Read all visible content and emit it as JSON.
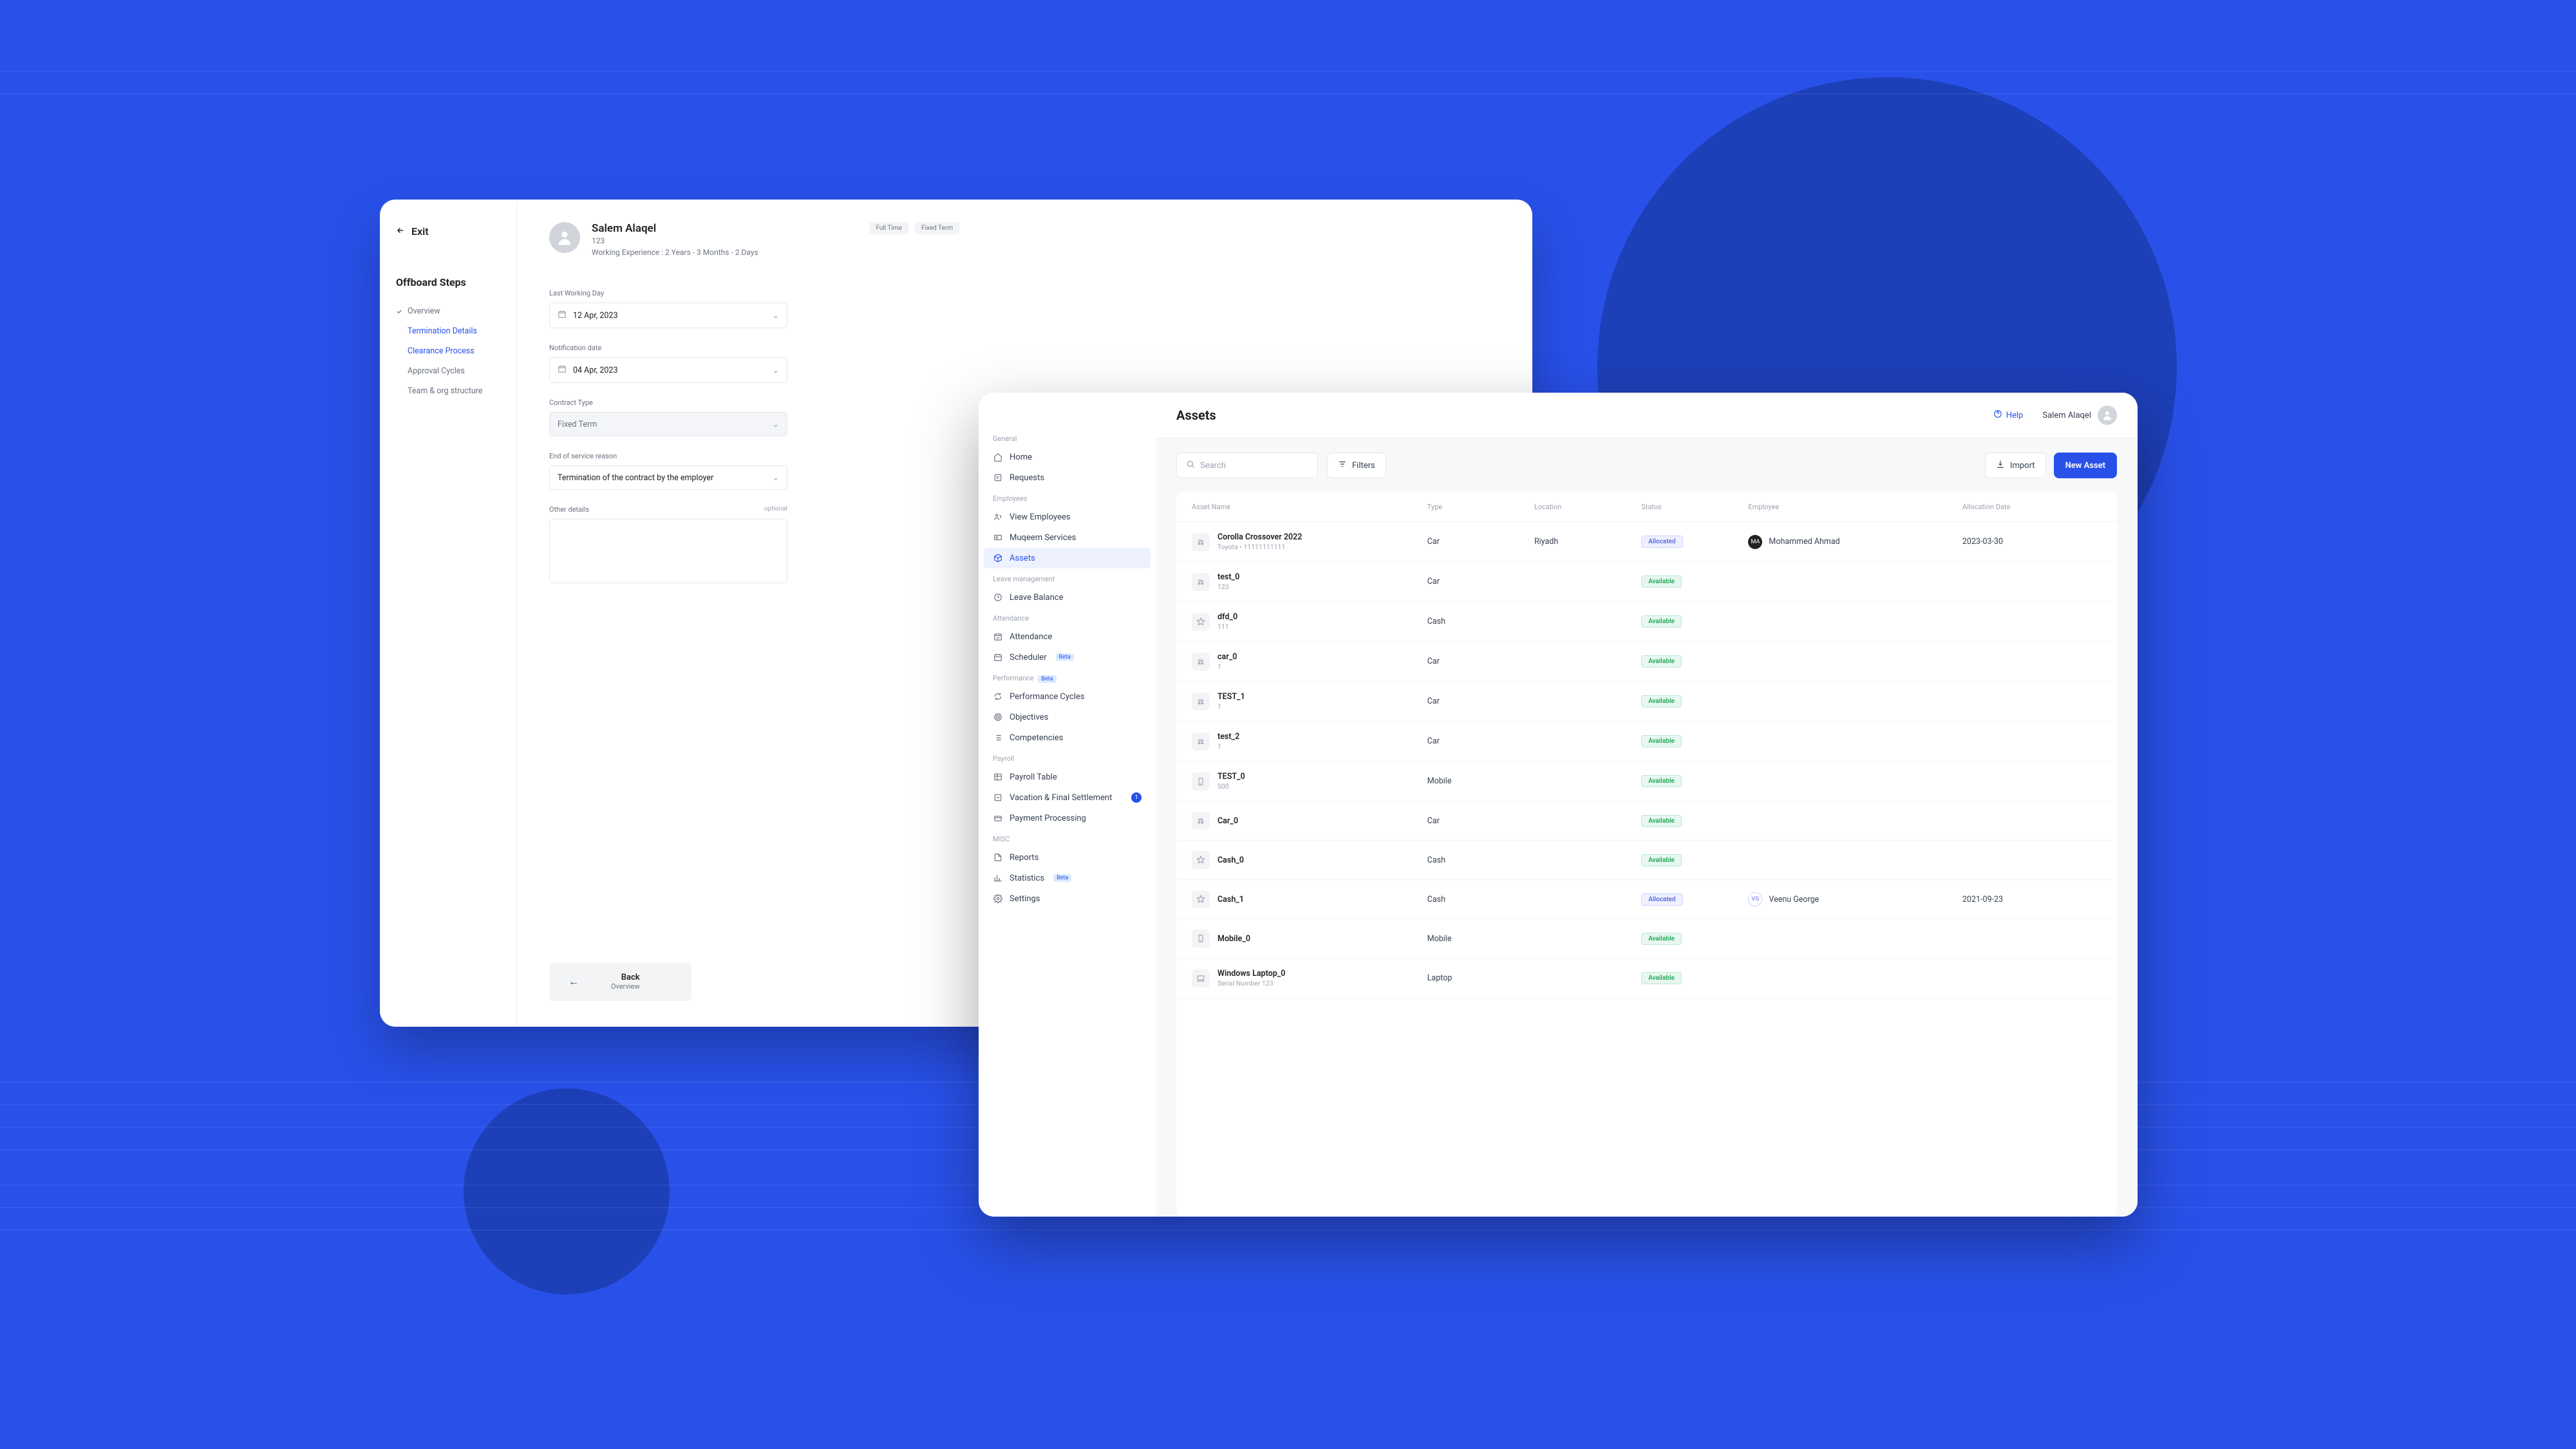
{
  "offboard": {
    "exit_label": "Exit",
    "steps_title": "Offboard Steps",
    "steps": [
      {
        "label": "Overview",
        "state": "done"
      },
      {
        "label": "Termination Details",
        "state": "active"
      },
      {
        "label": "Clearance Process",
        "state": "active"
      },
      {
        "label": "Approval Cycles",
        "state": "pending"
      },
      {
        "label": "Team & org structure",
        "state": "pending"
      }
    ],
    "employee": {
      "name": "Salem Alaqel",
      "id": "123",
      "experience": "Working Experience : 2 Years - 3 Months - 2 Days",
      "tags": [
        "Full Time",
        "Fixed Term"
      ]
    },
    "form": {
      "last_working_day": {
        "label": "Last Working Day",
        "value": "12 Apr, 2023"
      },
      "notification_date": {
        "label": "Notification date",
        "value": "04 Apr, 2023"
      },
      "contract_type": {
        "label": "Contract Type",
        "value": "Fixed Term"
      },
      "end_reason": {
        "label": "End of service reason",
        "value": "Termination of the contract by the employer"
      },
      "other_details": {
        "label": "Other details",
        "optional": "optional"
      }
    },
    "footer": {
      "back": "Back",
      "back_sub": "Overview"
    }
  },
  "assets": {
    "title": "Assets",
    "help": "Help",
    "current_user": "Salem Alaqel",
    "search_placeholder": "Search",
    "filters_label": "Filters",
    "import_label": "Import",
    "new_asset_label": "New Asset",
    "sidebar": {
      "groups": [
        {
          "label": "General",
          "items": [
            {
              "label": "Home",
              "icon": "home-icon"
            },
            {
              "label": "Requests",
              "icon": "requests-icon"
            }
          ]
        },
        {
          "label": "Employees",
          "items": [
            {
              "label": "View Employees",
              "icon": "users-icon"
            },
            {
              "label": "Muqeem Services",
              "icon": "id-icon"
            },
            {
              "label": "Assets",
              "icon": "box-icon",
              "active": true
            }
          ]
        },
        {
          "label": "Leave management",
          "items": [
            {
              "label": "Leave Balance",
              "icon": "clock-icon"
            }
          ]
        },
        {
          "label": "Attendance",
          "items": [
            {
              "label": "Attendance",
              "icon": "calendar-check-icon"
            },
            {
              "label": "Scheduler",
              "icon": "scheduler-icon",
              "beta": true
            }
          ]
        },
        {
          "label": "Performance",
          "beta": true,
          "items": [
            {
              "label": "Performance Cycles",
              "icon": "cycle-icon"
            },
            {
              "label": "Objectives",
              "icon": "target-icon"
            },
            {
              "label": "Competencies",
              "icon": "list-icon"
            }
          ]
        },
        {
          "label": "Payroll",
          "items": [
            {
              "label": "Payroll Table",
              "icon": "table-icon"
            },
            {
              "label": "Vacation & Final Settlement",
              "icon": "settlement-icon",
              "count": 1
            },
            {
              "label": "Payment Processing",
              "icon": "payment-icon"
            }
          ]
        },
        {
          "label": "MISC",
          "items": [
            {
              "label": "Reports",
              "icon": "report-icon"
            },
            {
              "label": "Statistics",
              "icon": "stats-icon",
              "beta": true
            },
            {
              "label": "Settings",
              "icon": "gear-icon"
            }
          ]
        }
      ]
    },
    "table": {
      "columns": [
        "Asset Name",
        "Type",
        "Location",
        "Status",
        "Employee",
        "Allocation Date"
      ],
      "rows": [
        {
          "name": "Corolla Crossover 2022",
          "sub": "Toyota • 11111111111",
          "icon": "car-icon",
          "type": "Car",
          "location": "Riyadh",
          "status": "Allocated",
          "employee": "Mohammed Ahmad",
          "emp_av": "solid",
          "date": "2023-03-30"
        },
        {
          "name": "test_0",
          "sub": "123",
          "icon": "car-icon",
          "type": "Car",
          "location": "",
          "status": "Available",
          "employee": "",
          "date": ""
        },
        {
          "name": "dfd_0",
          "sub": "111",
          "icon": "star-icon",
          "type": "Cash",
          "location": "",
          "status": "Available",
          "employee": "",
          "date": ""
        },
        {
          "name": "car_0",
          "sub": "1",
          "icon": "car-icon",
          "type": "Car",
          "location": "",
          "status": "Available",
          "employee": "",
          "date": ""
        },
        {
          "name": "TEST_1",
          "sub": "1",
          "icon": "car-icon",
          "type": "Car",
          "location": "",
          "status": "Available",
          "employee": "",
          "date": ""
        },
        {
          "name": "test_2",
          "sub": "1",
          "icon": "car-icon",
          "type": "Car",
          "location": "",
          "status": "Available",
          "employee": "",
          "date": ""
        },
        {
          "name": "TEST_0",
          "sub": "500",
          "icon": "mobile-icon",
          "type": "Mobile",
          "location": "",
          "status": "Available",
          "employee": "",
          "date": ""
        },
        {
          "name": "Car_0",
          "sub": "",
          "icon": "car-icon",
          "type": "Car",
          "location": "",
          "status": "Available",
          "employee": "",
          "date": ""
        },
        {
          "name": "Cash_0",
          "sub": "",
          "icon": "star-icon",
          "type": "Cash",
          "location": "",
          "status": "Available",
          "employee": "",
          "date": ""
        },
        {
          "name": "Cash_1",
          "sub": "",
          "icon": "star-icon",
          "type": "Cash",
          "location": "",
          "status": "Allocated",
          "employee": "Veenu George",
          "emp_av": "ring",
          "date": "2021-09-23"
        },
        {
          "name": "Mobile_0",
          "sub": "",
          "icon": "mobile-icon",
          "type": "Mobile",
          "location": "",
          "status": "Available",
          "employee": "",
          "date": ""
        },
        {
          "name": "Windows Laptop_0",
          "sub": "Serial Number 123",
          "icon": "laptop-icon",
          "type": "Laptop",
          "location": "",
          "status": "Available",
          "employee": "",
          "date": ""
        }
      ]
    }
  }
}
